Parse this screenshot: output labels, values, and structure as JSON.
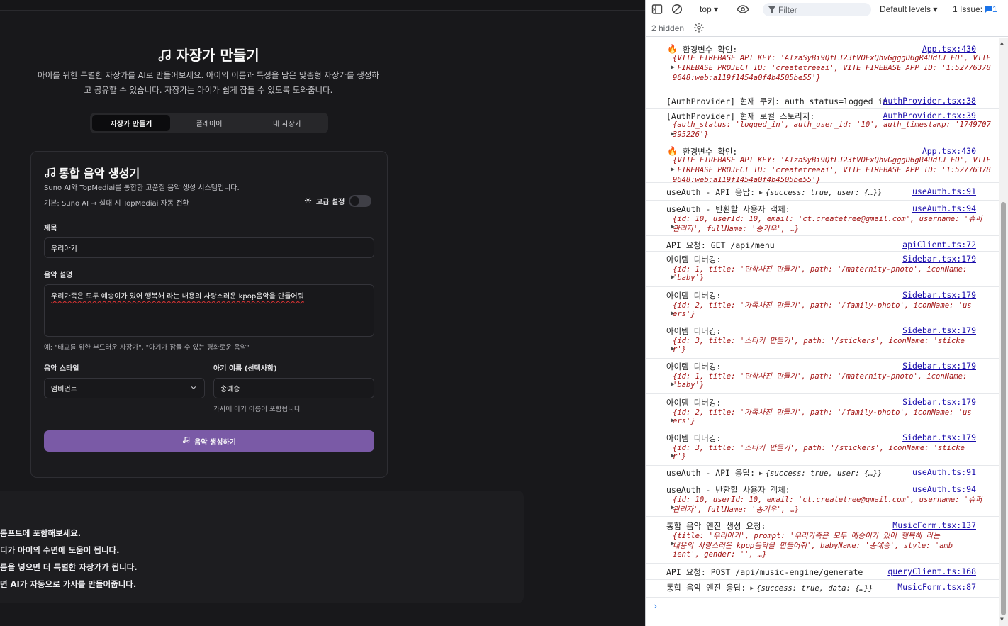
{
  "app": {
    "title": "자장가 만들기",
    "description_line1": "아이를 위한 특별한 자장가를 AI로 만들어보세요. 아이의 이름과 특성을 담은 맞춤형 자장가를 생성하",
    "description_line2": "고 공유할 수 있습니다. 자장가는 아이가 쉽게 잠들 수 있도록 도와줍니다.",
    "tabs": [
      {
        "label": "자장가 만들기",
        "active": true
      },
      {
        "label": "플레이어",
        "active": false
      },
      {
        "label": "내 자장가",
        "active": false
      }
    ],
    "card": {
      "title": "통합 음악 생성기",
      "subtitle": "Suno AI와 TopMediai를 통합한 고품질 음악 생성 시스템입니다.",
      "default_note": "기본: Suno AI → 실패 시 TopMediai 자동 전환",
      "advanced_label": "고급 설정",
      "title_label": "제목",
      "title_value": "우리아기",
      "desc_label": "음악 설명",
      "desc_value": "우리가족은 모두 예승이가 있어 행복해 라는 내용의 사랑스러운 kpop음악을 만들어줘",
      "desc_hint": "예: \"태교를 위한 부드러운 자장가\", \"아기가 잠들 수 있는 평화로운 음악\"",
      "style_label": "음악 스타일",
      "style_value": "앰비언트",
      "baby_label": "아기 이름 (선택사항)",
      "baby_value": "송예승",
      "baby_hint": "가사에 아기 이름이 포함됩니다",
      "generate_label": "음악 생성하기"
    },
    "tips": [
      "롬프트에 포함해보세요.",
      "디가 아이의 수면에 도움이 됩니다.",
      "름을 넣으면 더 특별한 자장가가 됩니다.",
      "면 AI가 자동으로 가사를 만들어줍니다."
    ]
  },
  "devtools": {
    "context": "top",
    "filter_placeholder": "Filter",
    "levels": "Default levels",
    "issues_text": "1 Issue:",
    "issues_count": "1",
    "hidden_text": "2 hidden",
    "accent": "#1a73e8",
    "logs": [
      {
        "msg": "환경변수 확인:",
        "src": "App.tsx:430",
        "fire": true,
        "o1": "{VITE_FIREBASE_API_KEY: 'AIzaSyBi9QfLJ23tVOExQhvGgggD6gR4UdTJ_FO', VITE",
        "o2": "_FIREBASE_PROJECT_ID: 'createtreeai', VITE_FIREBASE_APP_ID: '1:52776378",
        "o3": "9648:web:a119f1454a0f4b4505be55'}"
      },
      {
        "msg": "[AuthProvider] 현재 쿠키: auth_status=logged_in",
        "src": "AuthProvider.tsx:38"
      },
      {
        "msg": "[AuthProvider] 현재 로컬 스토리지:",
        "src": "AuthProvider.tsx:39",
        "o1": "{auth_status: 'logged_in', auth_user_id: '10', auth_timestamp: '1749707",
        "o2": "395226'}"
      },
      {
        "msg": "환경변수 확인:",
        "src": "App.tsx:430",
        "fire": true,
        "o1": "{VITE_FIREBASE_API_KEY: 'AIzaSyBi9QfLJ23tVOExQhvGgggD6gR4UdTJ_FO', VITE",
        "o2": "_FIREBASE_PROJECT_ID: 'createtreeai', VITE_FIREBASE_APP_ID: '1:52776378",
        "o3": "9648:web:a119f1454a0f4b4505be55'}"
      },
      {
        "msg": "useAuth - API 응답:",
        "src": "useAuth.ts:91",
        "tail": "{success: true, user: {…}}"
      },
      {
        "msg": "useAuth - 반환할 사용자 객체:",
        "src": "useAuth.ts:94",
        "o1": "{id: 10, userId: 10, email: 'ct.createtree@gmail.com', username: '슈퍼",
        "o2": "관리자', fullName: '송기우', …}"
      },
      {
        "msg": "API 요청: GET /api/menu",
        "src": "apiClient.ts:72"
      },
      {
        "msg": "아이템 디버깅:",
        "src": "Sidebar.tsx:179",
        "o1": "{id: 1, title: '만삭사진 만들기', path: '/maternity-photo', iconName:",
        "o2": "'baby'}"
      },
      {
        "msg": "아이템 디버깅:",
        "src": "Sidebar.tsx:179",
        "o1": "{id: 2, title: '가족사진 만들기', path: '/family-photo', iconName: 'us",
        "o2": "ers'}"
      },
      {
        "msg": "아이템 디버깅:",
        "src": "Sidebar.tsx:179",
        "o1": "{id: 3, title: '스티커 만들기', path: '/stickers', iconName: 'sticke",
        "o2": "r'}"
      },
      {
        "msg": "아이템 디버깅:",
        "src": "Sidebar.tsx:179",
        "o1": "{id: 1, title: '만삭사진 만들기', path: '/maternity-photo', iconName:",
        "o2": "'baby'}"
      },
      {
        "msg": "아이템 디버깅:",
        "src": "Sidebar.tsx:179",
        "o1": "{id: 2, title: '가족사진 만들기', path: '/family-photo', iconName: 'us",
        "o2": "ers'}"
      },
      {
        "msg": "아이템 디버깅:",
        "src": "Sidebar.tsx:179",
        "o1": "{id: 3, title: '스티커 만들기', path: '/stickers', iconName: 'sticke",
        "o2": "r'}"
      },
      {
        "msg": "useAuth - API 응답:",
        "src": "useAuth.ts:91",
        "tail": "{success: true, user: {…}}"
      },
      {
        "msg": "useAuth - 반환할 사용자 객체:",
        "src": "useAuth.ts:94",
        "o1": "{id: 10, userId: 10, email: 'ct.createtree@gmail.com', username: '슈퍼",
        "o2": "관리자', fullName: '송기우', …}"
      },
      {
        "msg": "통합 음악 엔진 생성 요청:",
        "src": "MusicForm.tsx:137",
        "o1": "{title: '우리아기', prompt: '우리가족은 모두 예승이가 있어 행복해 라는",
        "o2": "내용의 사랑스러운 kpop음악을 만들어줘', babyName: '송예승', style: 'amb",
        "o3": "ient', gender: '', …}"
      },
      {
        "msg": "API 요청: POST /api/music-engine/generate",
        "src": "queryClient.ts:168"
      },
      {
        "msg": "통합 음악 엔진 응답:",
        "src": "MusicForm.tsx:87",
        "tail": "{success: true, data: {…}}"
      }
    ]
  }
}
